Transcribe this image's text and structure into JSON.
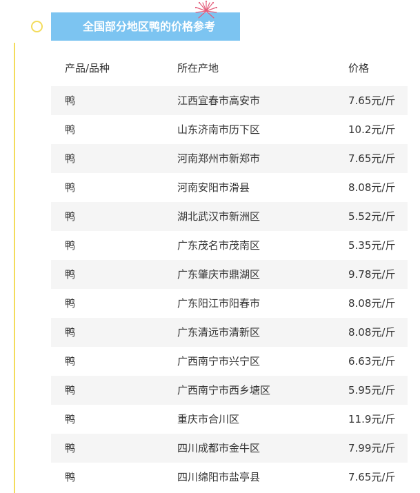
{
  "title": "全国部分地区鸭的价格参考",
  "colors": {
    "banner": "#7cc4f1",
    "timeline": "#f3dc5c",
    "stripe": "#f5f5f5",
    "firework": "#e35d7b"
  },
  "icons": {
    "firework": "firework-icon",
    "timeline_dot": "circle-outline-icon"
  },
  "table": {
    "headers": {
      "product": "产品/品种",
      "origin": "所在产地",
      "price": "价格"
    },
    "rows": [
      {
        "product": "鸭",
        "origin": "江西宜春市高安市",
        "price": "7.65元/斤"
      },
      {
        "product": "鸭",
        "origin": "山东济南市历下区",
        "price": "10.2元/斤"
      },
      {
        "product": "鸭",
        "origin": "河南郑州市新郑市",
        "price": "7.65元/斤"
      },
      {
        "product": "鸭",
        "origin": "河南安阳市滑县",
        "price": "8.08元/斤"
      },
      {
        "product": "鸭",
        "origin": "湖北武汉市新洲区",
        "price": "5.52元/斤"
      },
      {
        "product": "鸭",
        "origin": "广东茂名市茂南区",
        "price": "5.35元/斤"
      },
      {
        "product": "鸭",
        "origin": "广东肇庆市鼎湖区",
        "price": "9.78元/斤"
      },
      {
        "product": "鸭",
        "origin": "广东阳江市阳春市",
        "price": "8.08元/斤"
      },
      {
        "product": "鸭",
        "origin": "广东清远市清新区",
        "price": "8.08元/斤"
      },
      {
        "product": "鸭",
        "origin": "广西南宁市兴宁区",
        "price": "6.63元/斤"
      },
      {
        "product": "鸭",
        "origin": "广西南宁市西乡塘区",
        "price": "5.95元/斤"
      },
      {
        "product": "鸭",
        "origin": "重庆市合川区",
        "price": "11.9元/斤"
      },
      {
        "product": "鸭",
        "origin": "四川成都市金牛区",
        "price": "7.99元/斤"
      },
      {
        "product": "鸭",
        "origin": "四川绵阳市盐亭县",
        "price": "7.65元/斤"
      }
    ]
  }
}
